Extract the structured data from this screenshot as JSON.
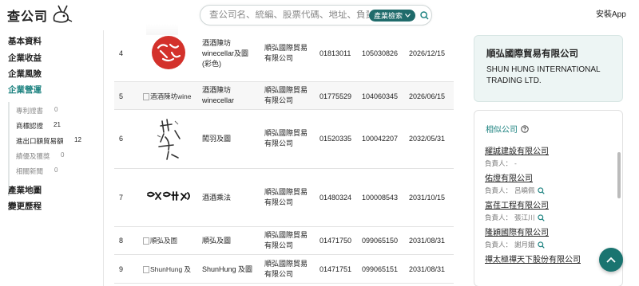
{
  "header": {
    "logo_text": "查公司",
    "search_placeholder": "查公司名、統編、股票代碼、地址、負責人",
    "search_mode": "產業檢索",
    "install_app": "安裝App"
  },
  "sidebar": {
    "items": [
      {
        "label": "基本資料"
      },
      {
        "label": "企業收益"
      },
      {
        "label": "企業風險"
      },
      {
        "label": "企業營運"
      }
    ],
    "sub_items": [
      {
        "label": "專利證書",
        "count": "0"
      },
      {
        "label": "商標認證",
        "count": "21"
      },
      {
        "label": "進出口額貿易額",
        "count": "12"
      },
      {
        "label": "績優及獲獎",
        "count": "0"
      },
      {
        "label": "相關新聞",
        "count": "0"
      }
    ],
    "bottom_items": [
      {
        "label": "產業地圖"
      },
      {
        "label": "變更歷程"
      }
    ]
  },
  "table": {
    "rows": [
      {
        "no": "4",
        "img_alt": "",
        "name": "酒酒陳坊\nwinecellar及圖\n(彩色)",
        "owner": "順弘國際貿易\n有限公司",
        "reg_no": "01813011",
        "app_no": "105030826",
        "date": "2026/12/15"
      },
      {
        "no": "5",
        "img_alt": "酒酒陳坊wine",
        "name": "酒酒陳坊\nwinecellar",
        "owner": "順弘國際貿易\n有限公司",
        "reg_no": "01775529",
        "app_no": "104060345",
        "date": "2026/06/15"
      },
      {
        "no": "6",
        "img_alt": "",
        "name": "闖羽及圖",
        "owner": "順弘國際貿易\n有限公司",
        "reg_no": "01520335",
        "app_no": "100042207",
        "date": "2032/05/31"
      },
      {
        "no": "7",
        "img_alt": "",
        "name": "酒酒乘法",
        "owner": "順弘國際貿易\n有限公司",
        "reg_no": "01480324",
        "app_no": "100008543",
        "date": "2031/10/15"
      },
      {
        "no": "8",
        "img_alt": "順弘及圖",
        "name": "順弘及圖",
        "owner": "順弘國際貿易\n有限公司",
        "reg_no": "01471750",
        "app_no": "099065150",
        "date": "2031/08/31"
      },
      {
        "no": "9",
        "img_alt": "ShunHung 及",
        "name": "ShunHung 及圖",
        "owner": "順弘國際貿易\n有限公司",
        "reg_no": "01471751",
        "app_no": "099065151",
        "date": "2031/08/31"
      }
    ]
  },
  "company": {
    "name": "順弘國際貿易有限公司",
    "name_en": "SHUN HUNG INTERNATIONAL TRADING LTD."
  },
  "related": {
    "title": "相似公司",
    "owner_prefix": "負責人：",
    "items": [
      {
        "name": "耀誠建設有限公司",
        "owner": "-",
        "search": false
      },
      {
        "name": "佑燈有限公司",
        "owner": "呂曉佩",
        "search": true
      },
      {
        "name": "富荏工程有限公司",
        "owner": "張江川",
        "search": true
      },
      {
        "name": "隆穎國際有限公司",
        "owner": "謝月娥",
        "search": true
      },
      {
        "name": "禪太極禪天下股份有限公司",
        "owner": "",
        "search": false
      }
    ]
  },
  "colors": {
    "accent": "#19807e",
    "brand_dark": "#1f6b6b",
    "fab": "#1a7470",
    "card_bg": "#edf5f4"
  }
}
